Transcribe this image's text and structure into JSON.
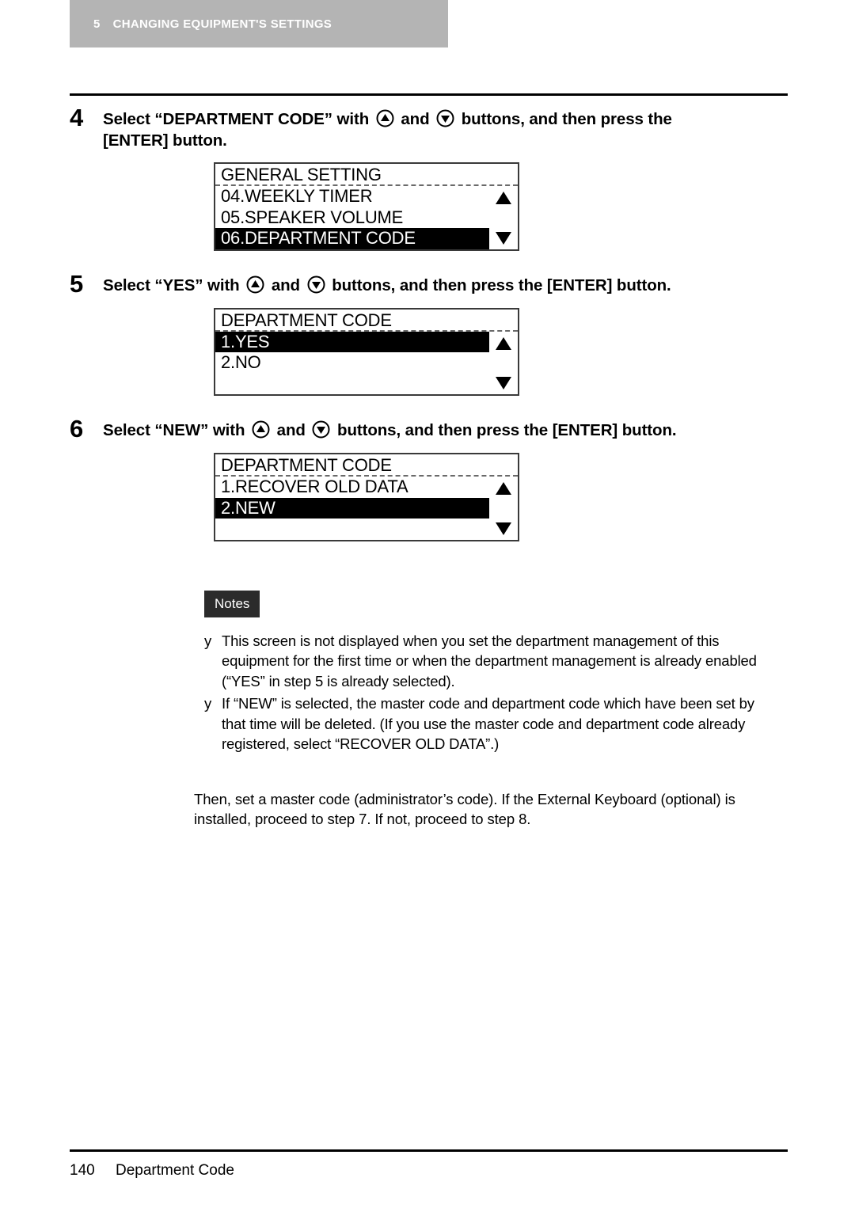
{
  "chapter": {
    "number": "5",
    "title": "CHANGING EQUIPMENT'S SETTINGS",
    "band_color": "#b4b4b4"
  },
  "steps": [
    {
      "number": "4",
      "text_part1": "Select “DEPARTMENT CODE” with",
      "text_part2": "and",
      "text_part3": "buttons, and then press the [ENTER] button.",
      "icon_up": "button-up-icon",
      "icon_down": "button-down-icon"
    },
    {
      "number": "5",
      "text_part1": "Select “YES” with",
      "text_part2": "and",
      "text_part3": "buttons, and then press the [ENTER] button.",
      "icon_up": "button-up-icon",
      "icon_down": "button-down-icon"
    },
    {
      "number": "6",
      "text_part1": "Select “NEW” with",
      "text_part2": "and",
      "text_part3": "buttons, and then press the [ENTER] button.",
      "icon_up": "button-up-icon",
      "icon_down": "button-down-icon"
    }
  ],
  "panels": [
    {
      "title": "GENERAL SETTING",
      "rows": [
        {
          "label": "04.WEEKLY TIMER",
          "selected": false
        },
        {
          "label": "05.SPEAKER VOLUME",
          "selected": false
        },
        {
          "label": "06.DEPARTMENT CODE",
          "selected": true
        }
      ],
      "scroll_up": "scroll-up-arrow",
      "scroll_down": "scroll-down-arrow"
    },
    {
      "title": "DEPARTMENT CODE",
      "rows": [
        {
          "label": "1.YES",
          "selected": true
        },
        {
          "label": "2.NO",
          "selected": false
        },
        {
          "label": "",
          "selected": false
        }
      ],
      "scroll_up": "scroll-up-arrow",
      "scroll_down": "scroll-down-arrow"
    },
    {
      "title": "DEPARTMENT CODE",
      "rows": [
        {
          "label": "1.RECOVER OLD DATA",
          "selected": false
        },
        {
          "label": "2.NEW",
          "selected": true
        },
        {
          "label": "",
          "selected": false
        }
      ],
      "scroll_up": "scroll-up-arrow",
      "scroll_down": "scroll-down-arrow"
    }
  ],
  "notes": {
    "badge": "Notes",
    "bullet": "y",
    "items": [
      "This screen is not displayed when you set the department management of this equipment for the first time or when the department management is already enabled (“YES” in step 5 is already selected).",
      "If “NEW” is selected, the master code and department code which have been set by that time will be deleted. (If you use the master code and department code already registered, select “RECOVER OLD DATA”.)"
    ]
  },
  "closing_paragraph": "Then, set a master code (administrator’s code). If the External Keyboard (optional) is installed, proceed to step 7. If not, proceed to step 8.",
  "footer": {
    "page_number": "140",
    "section_title": "Department Code"
  }
}
